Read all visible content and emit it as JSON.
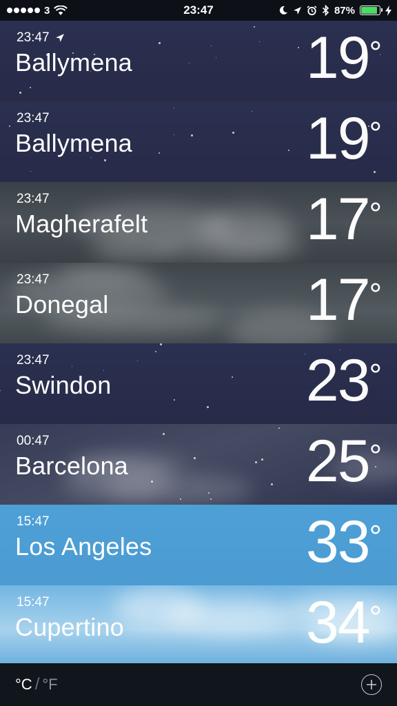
{
  "status_bar": {
    "carrier": "3",
    "time": "23:47",
    "battery_percent": "87%",
    "battery_level": 0.87,
    "icons": [
      "signal-dots-icon",
      "wifi-icon",
      "moon-icon",
      "location-arrow-icon",
      "alarm-icon",
      "bluetooth-icon",
      "battery-icon",
      "charging-bolt-icon"
    ],
    "battery_color": "#4cd964"
  },
  "cities": [
    {
      "time": "23:47",
      "name": "Ballymena",
      "temp": "19",
      "current_location": true,
      "style": "night"
    },
    {
      "time": "23:47",
      "name": "Ballymena",
      "temp": "19",
      "current_location": false,
      "style": "night"
    },
    {
      "time": "23:47",
      "name": "Magherafelt",
      "temp": "17",
      "current_location": false,
      "style": "cloudy-dark"
    },
    {
      "time": "23:47",
      "name": "Donegal",
      "temp": "17",
      "current_location": false,
      "style": "cloudy-dark2"
    },
    {
      "time": "23:47",
      "name": "Swindon",
      "temp": "23",
      "current_location": false,
      "style": "night"
    },
    {
      "time": "00:47",
      "name": "Barcelona",
      "temp": "25",
      "current_location": false,
      "style": "night-cloud"
    },
    {
      "time": "15:47",
      "name": "Los Angeles",
      "temp": "33",
      "current_location": false,
      "style": "day-blue"
    },
    {
      "time": "15:47",
      "name": "Cupertino",
      "temp": "34",
      "current_location": false,
      "style": "day-cloud"
    }
  ],
  "degree_symbol": "°",
  "bottom_bar": {
    "celsius_label": "°C",
    "separator": "/",
    "fahrenheit_label": "°F",
    "add_icon": "plus-circle-icon"
  }
}
